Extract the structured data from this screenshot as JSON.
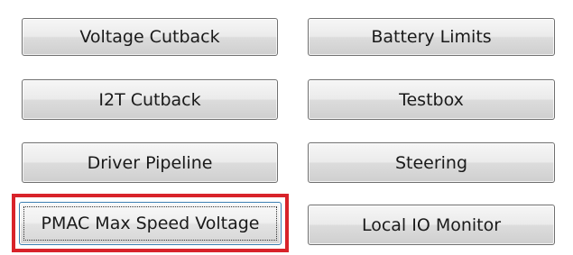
{
  "buttons": {
    "voltage_cutback": "Voltage Cutback",
    "battery_limits": "Battery Limits",
    "i2t_cutback": "I2T Cutback",
    "testbox": "Testbox",
    "driver_pipeline": "Driver Pipeline",
    "steering": "Steering",
    "pmac_max_speed_voltage": "PMAC Max Speed Voltage",
    "local_io_monitor": "Local IO Monitor"
  },
  "colors": {
    "highlight_border": "#d8232a",
    "button_border": "#707070",
    "focus_border": "#3c7fb1"
  }
}
